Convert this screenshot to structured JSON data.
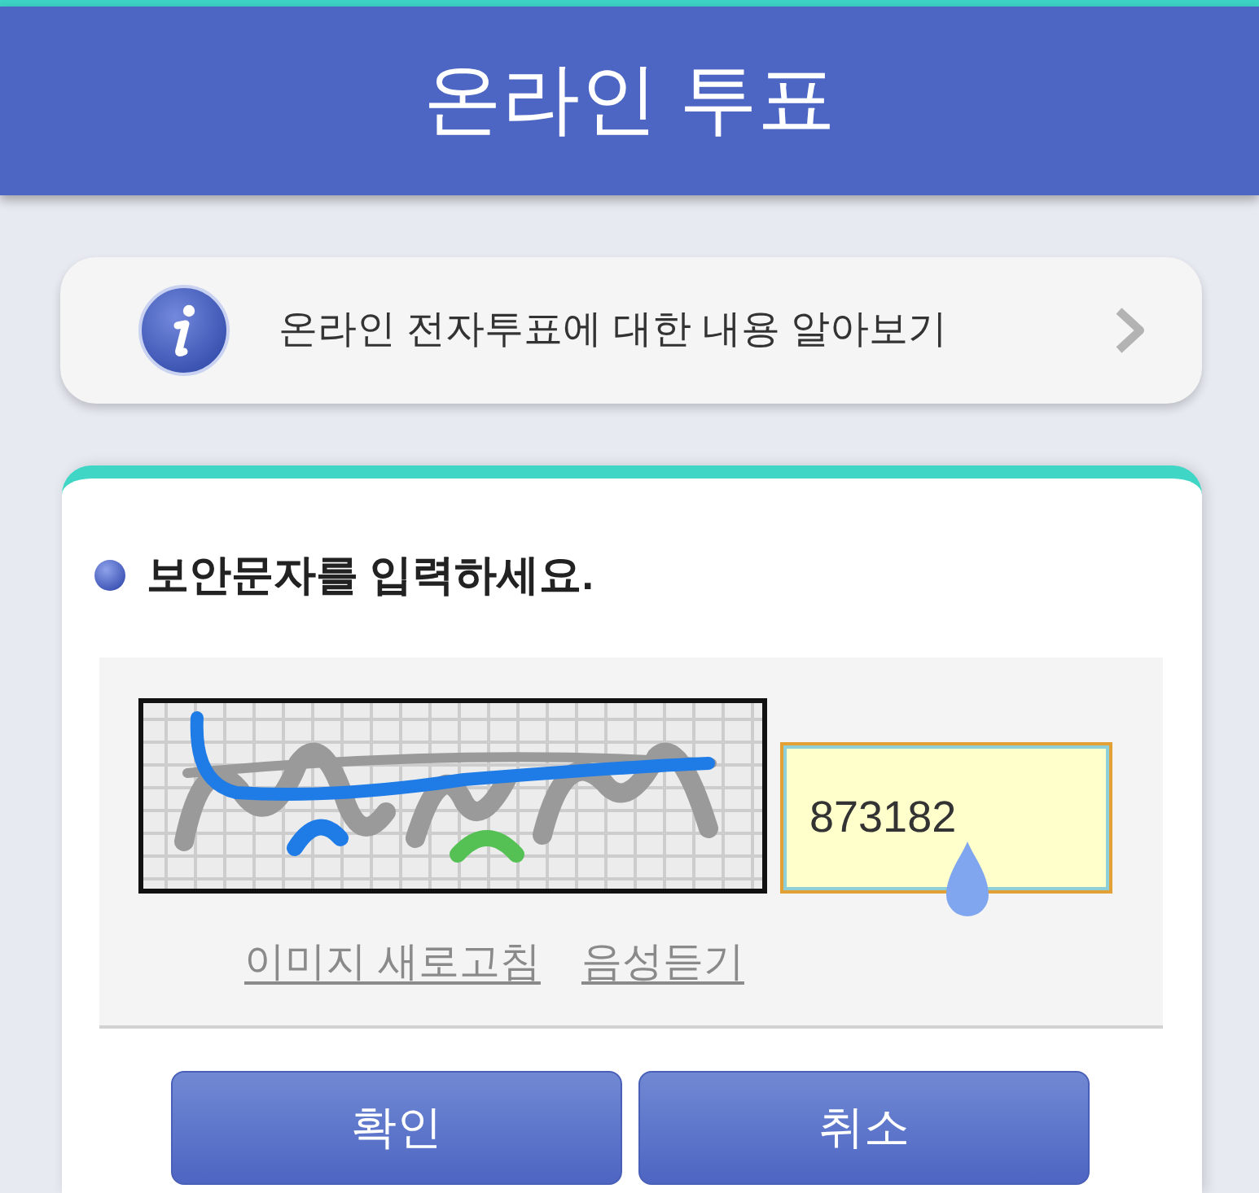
{
  "header": {
    "title": "온라인 투표"
  },
  "info_link": {
    "text": "온라인 전자투표에 대한 내용 알아보기"
  },
  "captcha": {
    "heading": "보안문자를 입력하세요.",
    "input": {
      "value": "873182",
      "focused": true
    },
    "links": [
      "이미지 새로고침",
      "음성듣기"
    ]
  },
  "buttons": [
    "확인",
    "취소"
  ]
}
